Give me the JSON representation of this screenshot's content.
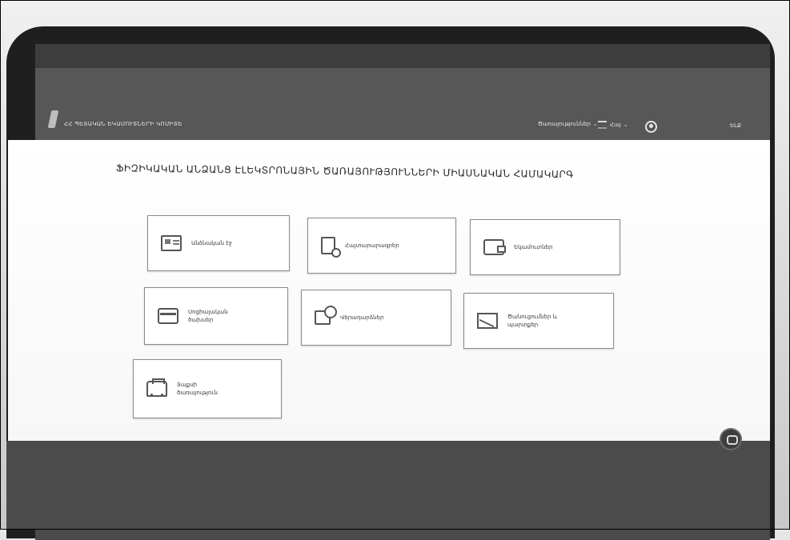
{
  "header": {
    "ministry_name": "ՀՀ ՊԵՏԱԿԱՆ ԵԿԱՄՈՒՏՆԵՐԻ ԿՈՄԻՏԵ",
    "services_label": "Ծառայություններ",
    "language_label": "Հայ",
    "exit_label": "ԵԼՔ"
  },
  "main": {
    "title": "ՖԻԶԻԿԱԿԱՆ ԱՆՁԱՆՑ ԷԼԵԿՏՐՈՆԱՅԻՆ ԾԱՌԱՅՈՒԹՅՈՒՆՆԵՐԻ ՄԻԱՍՆԱԿԱՆ ՀԱՄԱԿԱՐԳ",
    "cards": [
      {
        "label": "Անձնական էջ",
        "icon": "id-card-icon"
      },
      {
        "label": "Հայտարարագրեր",
        "icon": "document-icon"
      },
      {
        "label": "Եկամուտներ",
        "icon": "wallet-icon"
      },
      {
        "label": "Սոցիալական\nծախսեր",
        "icon": "card-wallet-icon"
      },
      {
        "label": "Վերադարձներ",
        "icon": "refund-icon"
      },
      {
        "label": "Ծանուցումներ և\nպարտքեր",
        "icon": "mail-icon"
      },
      {
        "label": "Տաքսի\nծառայություն",
        "icon": "taxi-icon"
      }
    ]
  },
  "icons": {
    "user": "user-icon",
    "chat": "chat-icon"
  },
  "colors": {
    "header_bg": "#575757",
    "content_bg": "#ffffff",
    "card_border": "#8a8a8a"
  }
}
